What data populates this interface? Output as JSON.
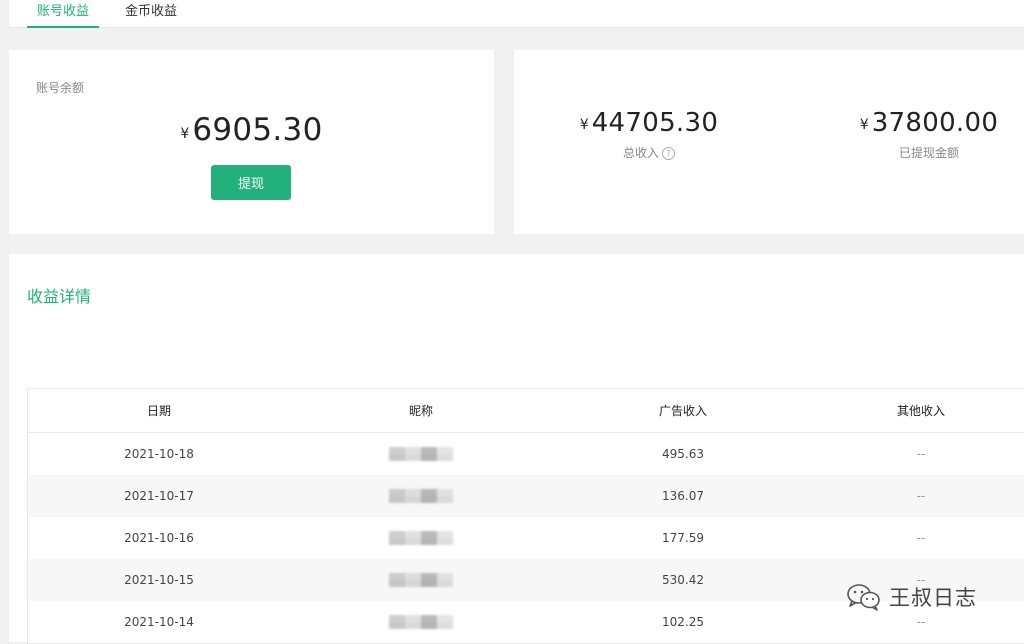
{
  "tabs": [
    {
      "label": "账号收益",
      "active": true
    },
    {
      "label": "金币收益",
      "active": false
    }
  ],
  "balance": {
    "label": "账号余额",
    "currency": "¥",
    "amount": "6905.30",
    "withdraw_label": "提现"
  },
  "totals": {
    "total_income": {
      "currency": "¥",
      "amount": "44705.30",
      "label": "总收入",
      "help_icon": "question-circle-icon"
    },
    "withdrawn": {
      "currency": "¥",
      "amount": "37800.00",
      "label": "已提现金额"
    }
  },
  "detail": {
    "title": "收益详情",
    "columns": [
      "日期",
      "昵称",
      "广告收入",
      "其他收入"
    ],
    "rows": [
      {
        "date": "2021-10-18",
        "ad_income": "495.63",
        "other_income": "--"
      },
      {
        "date": "2021-10-17",
        "ad_income": "136.07",
        "other_income": "--"
      },
      {
        "date": "2021-10-16",
        "ad_income": "177.59",
        "other_income": "--"
      },
      {
        "date": "2021-10-15",
        "ad_income": "530.42",
        "other_income": "--"
      },
      {
        "date": "2021-10-14",
        "ad_income": "102.25",
        "other_income": "--"
      }
    ]
  },
  "watermark": {
    "text": "王叔日志",
    "icon": "wechat-icon"
  },
  "colors": {
    "accent": "#22b07d"
  }
}
